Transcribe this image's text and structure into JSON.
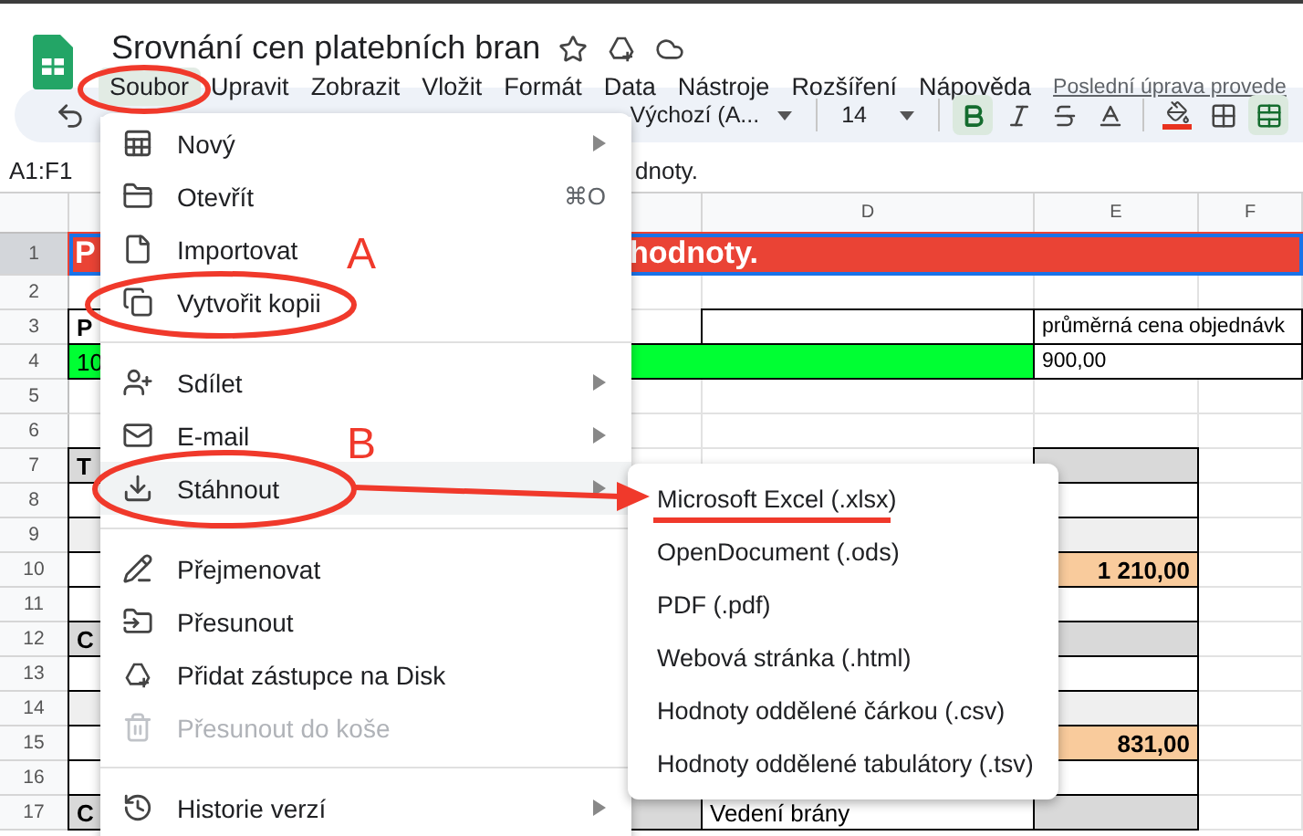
{
  "document": {
    "title": "Srovnání cen platebních bran"
  },
  "menubar": [
    {
      "label": "Soubor",
      "selected": true
    },
    {
      "label": "Upravit",
      "selected": false
    },
    {
      "label": "Zobrazit",
      "selected": false
    },
    {
      "label": "Vložit",
      "selected": false
    },
    {
      "label": "Formát",
      "selected": false
    },
    {
      "label": "Data",
      "selected": false
    },
    {
      "label": "Nástroje",
      "selected": false
    },
    {
      "label": "Rozšíření",
      "selected": false
    },
    {
      "label": "Nápověda",
      "selected": false
    }
  ],
  "last_edit_link": "Poslední úprava provede",
  "toolbar": {
    "font": "Výchozí (A...",
    "size": "14",
    "bold_on": true,
    "merge_on": true
  },
  "formula_bar": {
    "range": "A1:F1",
    "value": "dnoty."
  },
  "sheet": {
    "columns": [
      "D",
      "E",
      "F"
    ],
    "rows": [
      {
        "number": "1",
        "selected": true,
        "cells": {
          "a": {
            "text": "P",
            "kind": "red-head",
            "bold": true
          },
          "c": {
            "text": "hodnoty.",
            "kind": "red-tail",
            "bold": true
          }
        }
      },
      {
        "number": "2",
        "selected": false,
        "cells": {}
      },
      {
        "number": "3",
        "selected": false,
        "cells": {
          "a": {
            "text": "P",
            "kind": "boxed",
            "bold": true
          },
          "d": {
            "kind": "boxed"
          },
          "e": {
            "text": "průměrná cena objednávk",
            "kind": "boxed-wide",
            "bold": false
          }
        }
      },
      {
        "number": "4",
        "selected": false,
        "cells": {
          "a": {
            "text": "10",
            "kind": "green",
            "bold": false
          },
          "e": {
            "text": "900,00",
            "kind": "boxed-wide",
            "bold": false
          }
        }
      },
      {
        "number": "5",
        "selected": false,
        "cells": {}
      },
      {
        "number": "6",
        "selected": false,
        "cells": {}
      },
      {
        "number": "7",
        "selected": false,
        "cells": {
          "a": {
            "text": "T",
            "kind": "grey",
            "bold": true
          },
          "e": {
            "kind": "grey"
          }
        }
      },
      {
        "number": "8",
        "selected": false,
        "cells": {
          "a": {
            "kind": "boxed"
          },
          "e": {
            "kind": "boxed"
          }
        }
      },
      {
        "number": "9",
        "selected": false,
        "cells": {
          "a": {
            "kind": "light"
          },
          "e": {
            "kind": "light"
          }
        }
      },
      {
        "number": "10",
        "selected": false,
        "cells": {
          "a": {
            "kind": "boxed"
          },
          "e": {
            "text": "1 210,00",
            "kind": "orange",
            "bold": true
          }
        }
      },
      {
        "number": "11",
        "selected": false,
        "cells": {
          "a": {
            "kind": "boxed"
          },
          "e": {
            "kind": "boxed"
          }
        }
      },
      {
        "number": "12",
        "selected": false,
        "cells": {
          "a": {
            "text": "C",
            "kind": "grey",
            "bold": true
          },
          "e": {
            "kind": "grey"
          }
        }
      },
      {
        "number": "13",
        "selected": false,
        "cells": {
          "a": {
            "kind": "boxed"
          },
          "e": {
            "kind": "boxed"
          }
        }
      },
      {
        "number": "14",
        "selected": false,
        "cells": {
          "a": {
            "kind": "light"
          },
          "e": {
            "kind": "light"
          }
        }
      },
      {
        "number": "15",
        "selected": false,
        "cells": {
          "a": {
            "kind": "boxed"
          },
          "e": {
            "text": "831,00",
            "kind": "orange",
            "bold": true
          }
        }
      },
      {
        "number": "16",
        "selected": false,
        "cells": {
          "a": {
            "kind": "boxed"
          },
          "e": {
            "kind": "boxed"
          }
        }
      },
      {
        "number": "17",
        "selected": false,
        "cells": {
          "a": {
            "text": "C",
            "kind": "grey",
            "bold": true
          },
          "c": {
            "kind": "grey"
          },
          "d": {
            "text": "Vedení brány",
            "kind": "boxed",
            "bold": false
          },
          "e": {
            "kind": "grey"
          }
        }
      }
    ]
  },
  "file_menu": [
    {
      "kind": "item",
      "label": "Nový",
      "submenu": true,
      "highlighted": false,
      "disabled": false
    },
    {
      "kind": "item",
      "label": "Otevřít",
      "shortcut": "⌘O",
      "submenu": false,
      "highlighted": false,
      "disabled": false
    },
    {
      "kind": "item",
      "label": "Importovat",
      "submenu": false,
      "highlighted": false,
      "disabled": false
    },
    {
      "kind": "item",
      "label": "Vytvořit kopii",
      "submenu": false,
      "highlighted": false,
      "disabled": false
    },
    {
      "kind": "divider"
    },
    {
      "kind": "item",
      "label": "Sdílet",
      "submenu": true,
      "highlighted": false,
      "disabled": false
    },
    {
      "kind": "item",
      "label": "E-mail",
      "submenu": true,
      "highlighted": false,
      "disabled": false
    },
    {
      "kind": "item",
      "label": "Stáhnout",
      "submenu": true,
      "highlighted": true,
      "disabled": false
    },
    {
      "kind": "divider"
    },
    {
      "kind": "item",
      "label": "Přejmenovat",
      "submenu": false,
      "highlighted": false,
      "disabled": false
    },
    {
      "kind": "item",
      "label": "Přesunout",
      "submenu": false,
      "highlighted": false,
      "disabled": false
    },
    {
      "kind": "item",
      "label": "Přidat zástupce na Disk",
      "submenu": false,
      "highlighted": false,
      "disabled": false
    },
    {
      "kind": "item",
      "label": "Přesunout do koše",
      "submenu": false,
      "highlighted": false,
      "disabled": true
    },
    {
      "kind": "divider"
    },
    {
      "kind": "item",
      "label": "Historie verzí",
      "submenu": true,
      "highlighted": false,
      "disabled": false
    }
  ],
  "download_submenu": [
    "Microsoft Excel (.xlsx)",
    "OpenDocument (.ods)",
    "PDF (.pdf)",
    "Webová stránka (.html)",
    "Hodnoty oddělené čárkou (.csv)",
    "Hodnoty oddělené tabulátory (.tsv)"
  ],
  "annotations": {
    "labels": [
      "A",
      "B"
    ]
  }
}
